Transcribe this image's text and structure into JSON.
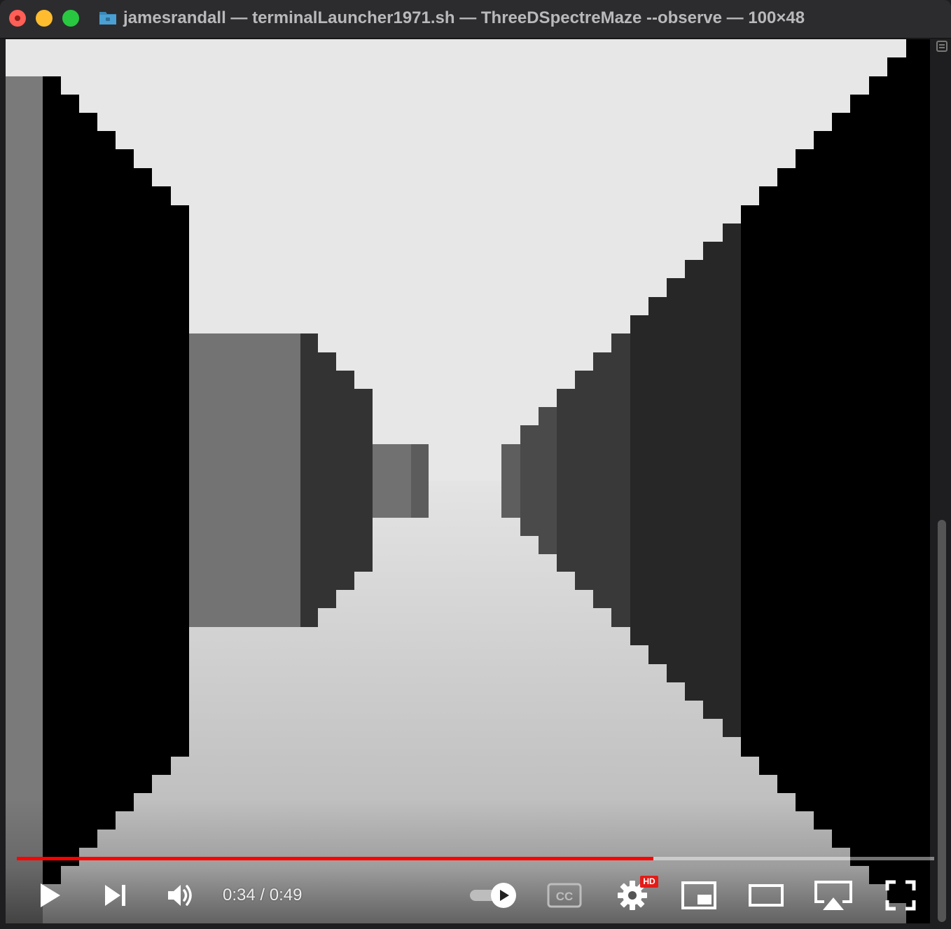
{
  "window": {
    "title": "jamesrandall — terminalLauncher1971.sh — ThreeDSpectreMaze --observe — 100×48"
  },
  "player": {
    "current_time": "0:34",
    "separator": " / ",
    "duration": "0:49",
    "progress": 0.6937,
    "hd_badge": "HD",
    "autoplay_on": true,
    "accent_color": "#ff0000"
  },
  "icons": [
    "play-icon",
    "next-icon",
    "volume-icon",
    "autoplay-toggle",
    "captions-icon",
    "settings-icon",
    "miniplayer-icon",
    "theater-mode-icon",
    "airplay-icon",
    "fullscreen-icon"
  ]
}
